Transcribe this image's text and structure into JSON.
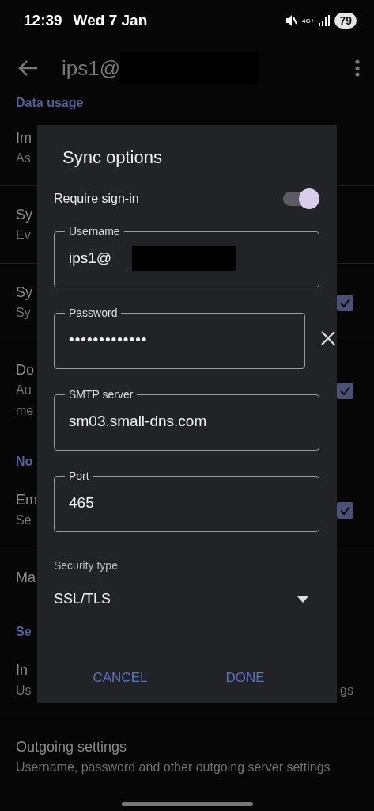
{
  "status_bar": {
    "time": "12:39",
    "date": "Wed 7 Jan",
    "network": "4G+",
    "battery": "79"
  },
  "app_bar": {
    "title": "ips1@",
    "redacted": true
  },
  "settings": [
    {
      "kind": "header",
      "title": "Data usage"
    },
    {
      "kind": "row",
      "title": "Im",
      "lines": [
        "As"
      ]
    },
    {
      "kind": "row",
      "title": "Sy",
      "lines": [
        "Ev"
      ]
    },
    {
      "kind": "checkbox_row",
      "title": "Sy",
      "lines": [
        "Sy"
      ],
      "checked": true
    },
    {
      "kind": "checkbox_row",
      "title": "Do",
      "lines": [
        "Au",
        "me"
      ],
      "checked": true
    },
    {
      "kind": "header",
      "title": "No"
    },
    {
      "kind": "checkbox_row",
      "title": "Em",
      "lines": [
        "Se"
      ],
      "checked": true
    },
    {
      "kind": "row",
      "title": "Ma"
    },
    {
      "kind": "header",
      "title": "Se"
    },
    {
      "kind": "row",
      "title": "In",
      "lines": [
        "Us"
      ],
      "trailing": "gs"
    },
    {
      "kind": "row",
      "title": "Outgoing settings",
      "lines": [
        "Username, password and other outgoing server settings"
      ]
    }
  ],
  "dialog": {
    "title": "Sync options",
    "require_sign_in": {
      "label": "Require sign-in",
      "on": true
    },
    "fields": [
      {
        "label": "Username",
        "value": "ips1@",
        "redacted": true,
        "clear_button": false
      },
      {
        "label": "Password",
        "value": "•••••••••••••",
        "redacted": false,
        "clear_button": true
      },
      {
        "label": "SMTP server",
        "value": "sm03.small-dns.com",
        "redacted": false,
        "clear_button": false
      },
      {
        "label": "Port",
        "value": "465",
        "redacted": false,
        "clear_button": false
      }
    ],
    "security": {
      "label": "Security type",
      "value": "SSL/TLS"
    },
    "buttons": [
      "CANCEL",
      "DONE"
    ]
  }
}
